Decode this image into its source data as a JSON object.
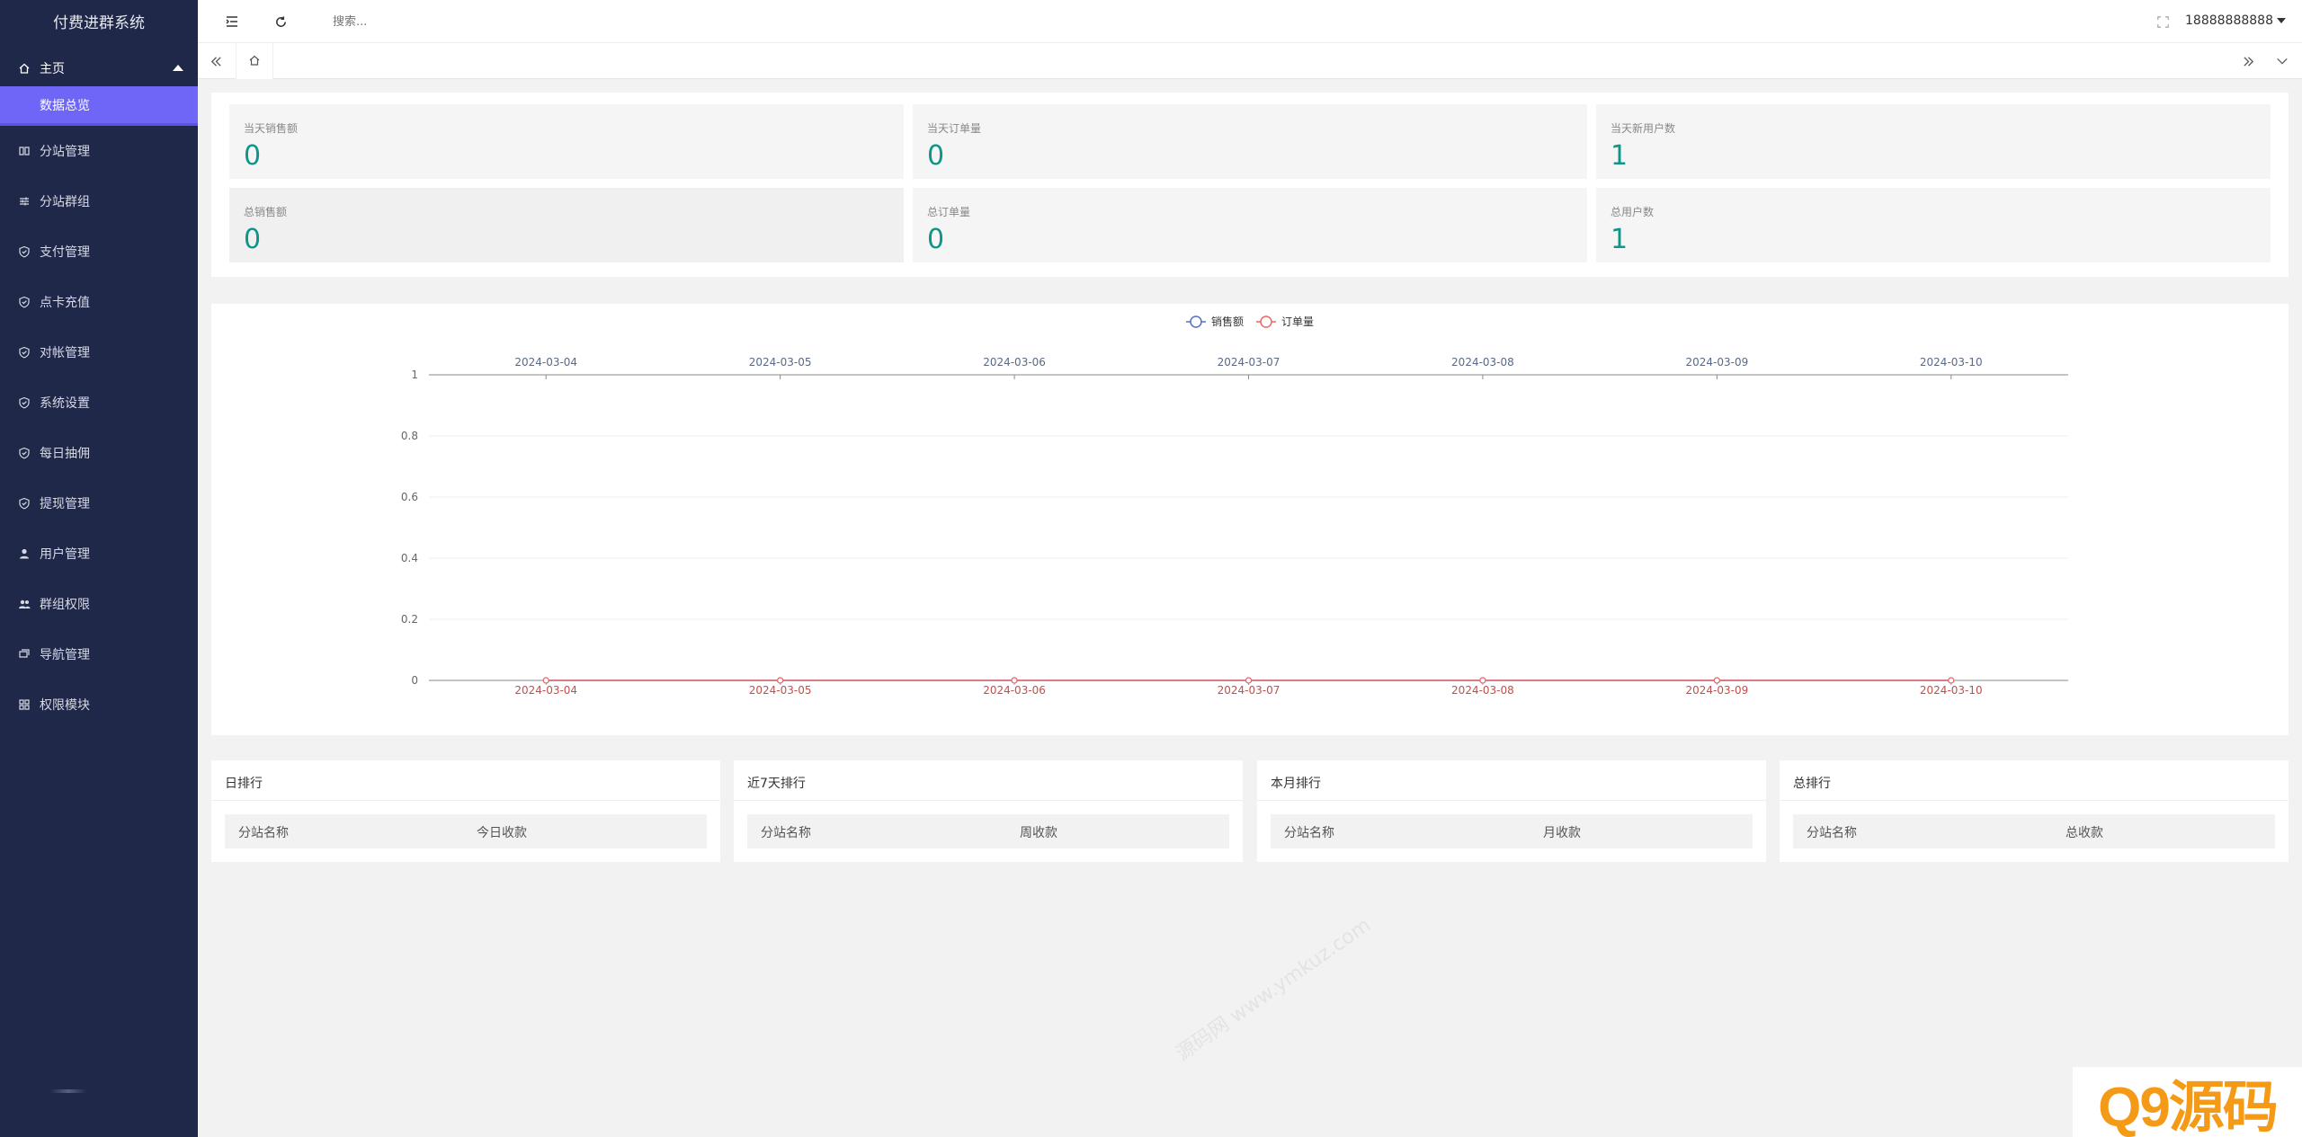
{
  "sidebar": {
    "brand": "付费进群系统",
    "group": {
      "label": "主页",
      "icon": "home-icon"
    },
    "active_sub": "数据总览",
    "items": [
      {
        "label": "分站管理",
        "icon": "columns-icon"
      },
      {
        "label": "分站群组",
        "icon": "sliders-icon"
      },
      {
        "label": "支付管理",
        "icon": "shield-icon"
      },
      {
        "label": "点卡充值",
        "icon": "shield-icon"
      },
      {
        "label": "对帐管理",
        "icon": "shield-icon"
      },
      {
        "label": "系统设置",
        "icon": "shield-icon"
      },
      {
        "label": "每日抽佣",
        "icon": "shield-icon"
      },
      {
        "label": "提现管理",
        "icon": "shield-icon"
      },
      {
        "label": "用户管理",
        "icon": "user-icon"
      },
      {
        "label": "群组权限",
        "icon": "users-icon"
      },
      {
        "label": "导航管理",
        "icon": "nav-icon"
      },
      {
        "label": "权限模块",
        "icon": "grid-icon"
      }
    ]
  },
  "header": {
    "search_placeholder": "搜索...",
    "username": "18888888888"
  },
  "stats": [
    {
      "label": "当天销售额",
      "value": "0"
    },
    {
      "label": "当天订单量",
      "value": "0"
    },
    {
      "label": "当天新用户数",
      "value": "1"
    },
    {
      "label": "总销售额",
      "value": "0"
    },
    {
      "label": "总订单量",
      "value": "0"
    },
    {
      "label": "总用户数",
      "value": "1"
    }
  ],
  "chart_data": {
    "type": "line",
    "categories": [
      "2024-03-04",
      "2024-03-05",
      "2024-03-06",
      "2024-03-07",
      "2024-03-08",
      "2024-03-09",
      "2024-03-10"
    ],
    "series": [
      {
        "name": "销售额",
        "values": [
          0,
          0,
          0,
          0,
          0,
          0,
          0
        ],
        "color": "#5470c6"
      },
      {
        "name": "订单量",
        "values": [
          0,
          0,
          0,
          0,
          0,
          0,
          0
        ],
        "color": "#ee6666"
      }
    ],
    "ylim": [
      0,
      1
    ],
    "yticks": [
      "0",
      "0.2",
      "0.4",
      "0.6",
      "0.8",
      "1"
    ],
    "legend": "top-center",
    "grid": true
  },
  "ranks": [
    {
      "title": "日排行",
      "col1": "分站名称",
      "col2": "今日收款"
    },
    {
      "title": "近7天排行",
      "col1": "分站名称",
      "col2": "周收款"
    },
    {
      "title": "本月排行",
      "col1": "分站名称",
      "col2": "月收款"
    },
    {
      "title": "总排行",
      "col1": "分站名称",
      "col2": "总收款"
    }
  ],
  "watermark": "源码网 www.ymkuz.com",
  "logo": "Q9源码"
}
